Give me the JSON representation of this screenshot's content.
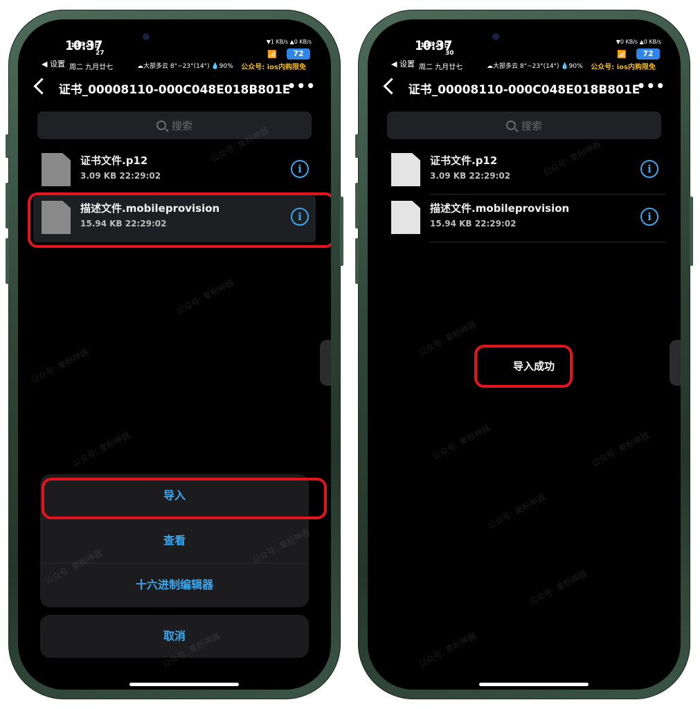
{
  "left": {
    "status_bar": {
      "time": "10:37",
      "date": "10月29日",
      "day": "27",
      "back_label": "◀ 设置",
      "week": "周二 九月廿七",
      "weather": "☁大部多云 8°~23°(14°) 💧90%",
      "speed": "▼1 KB/s ▲0 KB/s",
      "battery": "72",
      "promo": "公众号: ios内购限免"
    },
    "nav": {
      "title": "证书_00008110-000C048E018B801E",
      "more": "•••"
    },
    "search": {
      "placeholder": "搜索"
    },
    "files": [
      {
        "name": "证书文件.p12",
        "meta": "3.09 KB  22:29:02"
      },
      {
        "name": "描述文件.mobileprovision",
        "meta": "15.94 KB  22:29:02"
      }
    ],
    "action_sheet": {
      "import": "导入",
      "view": "查看",
      "hex_editor": "十六进制编辑器",
      "cancel": "取消"
    }
  },
  "right": {
    "status_bar": {
      "time": "10:37",
      "date": "10月29日",
      "day": "30",
      "back_label": "◀ 设置",
      "week": "周二 九月廿七",
      "weather": "☁大部多云 8°~23°(14°) 💧90%",
      "speed": "▼0 KB/s ▲0 KB/s",
      "battery": "72",
      "promo": "公众号: ios内购限免"
    },
    "nav": {
      "title": "证书_00008110-000C048E018B801E",
      "more": "•••"
    },
    "search": {
      "placeholder": "搜索"
    },
    "files": [
      {
        "name": "证书文件.p12",
        "meta": "3.09 KB  22:29:02"
      },
      {
        "name": "描述文件.mobileprovision",
        "meta": "15.94 KB  22:29:02"
      }
    ],
    "toast": "导入成功"
  },
  "watermark": "公众号: 果粉神器",
  "colors": {
    "accent": "#3ba9ef",
    "highlight": "#e3141b",
    "frame": "#2f4638"
  }
}
